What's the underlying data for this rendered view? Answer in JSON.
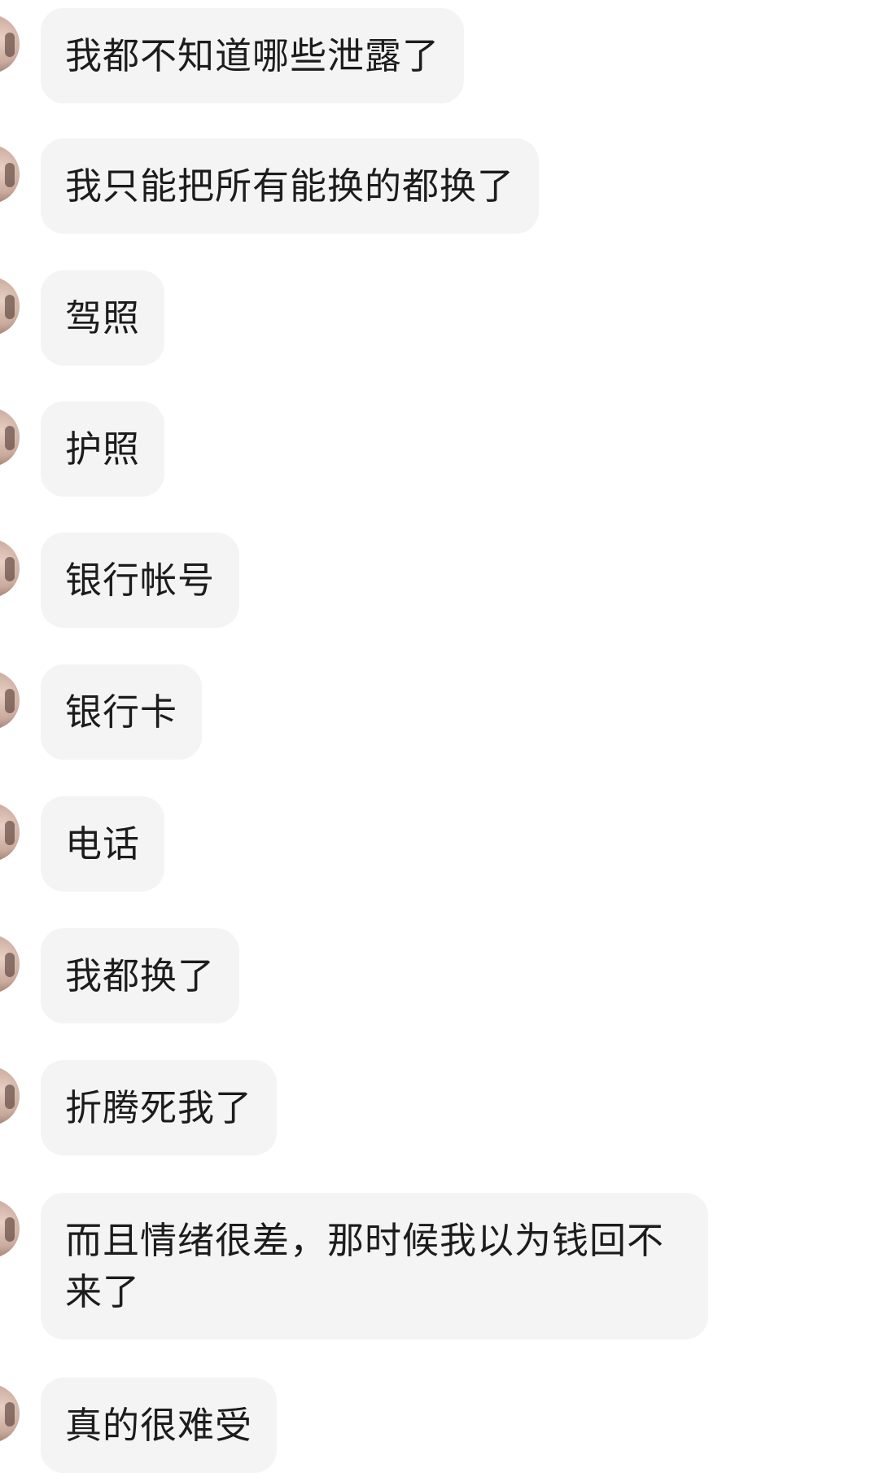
{
  "messages": [
    {
      "text": "我都不知道哪些泄露了"
    },
    {
      "text": "我只能把所有能换的都换了"
    },
    {
      "text": "驾照"
    },
    {
      "text": "护照"
    },
    {
      "text": "银行帐号"
    },
    {
      "text": "银行卡"
    },
    {
      "text": "电话"
    },
    {
      "text": "我都换了"
    },
    {
      "text": "折腾死我了"
    },
    {
      "text": "而且情绪很差，那时候我以为钱回不来了"
    },
    {
      "text": "真的很难受"
    }
  ]
}
